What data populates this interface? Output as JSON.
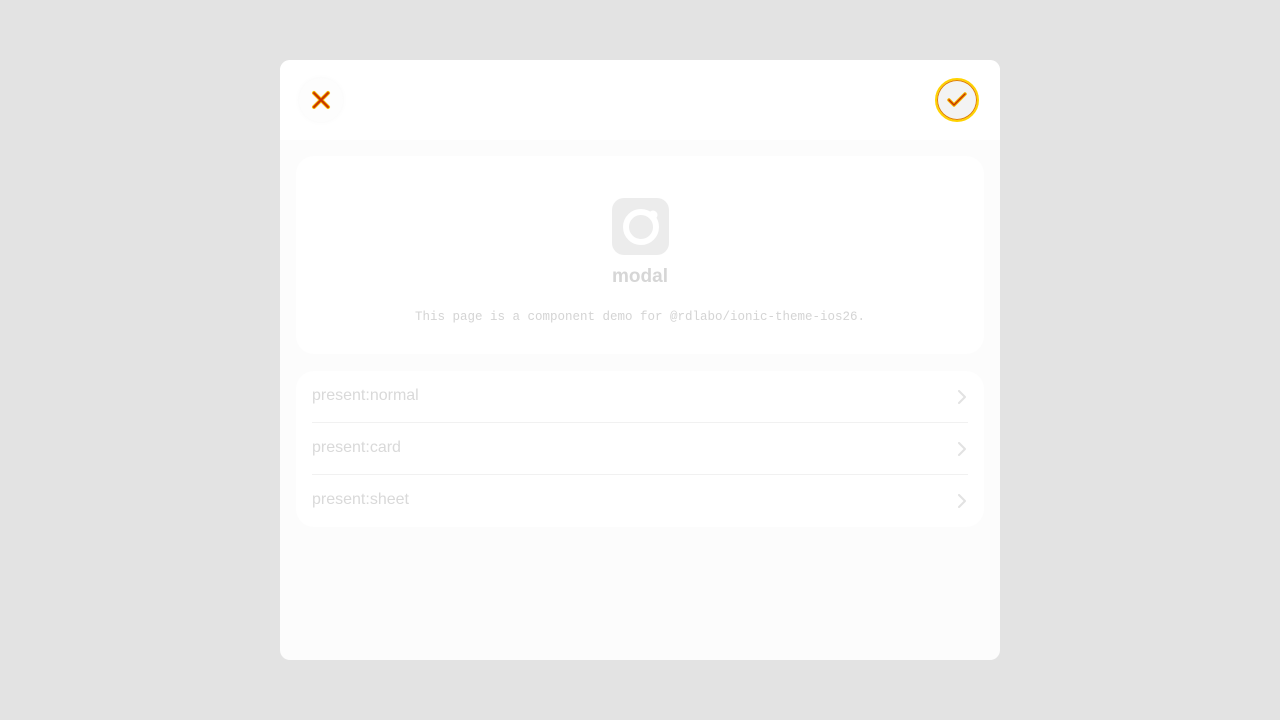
{
  "header": {
    "close_icon": "close-x-icon",
    "confirm_icon": "checkmark-icon",
    "accent_colors": {
      "close_icon": "#c83200",
      "confirm_ring": "#ffd200",
      "confirm_ring_inner": "#e07b00"
    }
  },
  "intro": {
    "logo_icon": "ionic-logo-icon",
    "title": "modal",
    "description": "This page is a component demo for @rdlabo/ionic-theme-ios26."
  },
  "list": {
    "items": [
      {
        "label": "present:normal",
        "icon": "chevron-right-icon"
      },
      {
        "label": "present:card",
        "icon": "chevron-right-icon"
      },
      {
        "label": "present:sheet",
        "icon": "chevron-right-icon"
      }
    ]
  }
}
